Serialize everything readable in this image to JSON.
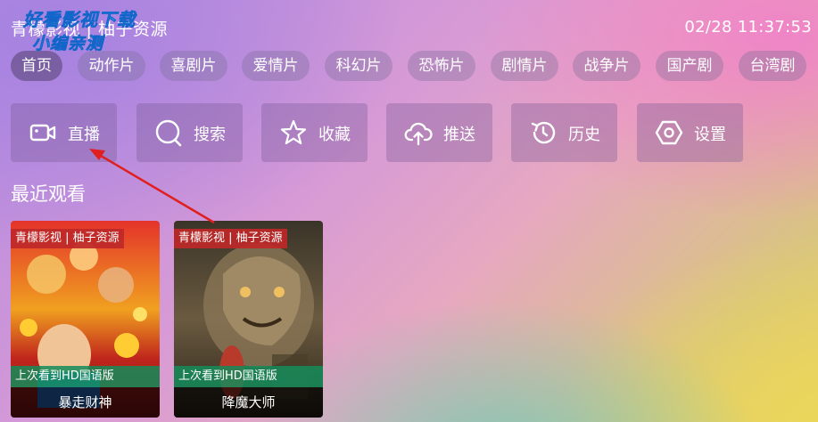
{
  "header": {
    "app_title": "青檬影视 | 柚子资源",
    "watermark_line1": "好看影视下载",
    "watermark_line2": "小编亲测",
    "clock": "02/28 11:37:53"
  },
  "tabs": [
    {
      "label": "首页",
      "active": true
    },
    {
      "label": "动作片"
    },
    {
      "label": "喜剧片"
    },
    {
      "label": "爱情片"
    },
    {
      "label": "科幻片"
    },
    {
      "label": "恐怖片"
    },
    {
      "label": "剧情片"
    },
    {
      "label": "战争片"
    },
    {
      "label": "国产剧"
    },
    {
      "label": "台湾剧"
    }
  ],
  "tiles": [
    {
      "label": "直播",
      "icon": "video-camera-icon"
    },
    {
      "label": "搜索",
      "icon": "search-icon"
    },
    {
      "label": "收藏",
      "icon": "star-icon"
    },
    {
      "label": "推送",
      "icon": "cloud-upload-icon"
    },
    {
      "label": "历史",
      "icon": "history-icon"
    },
    {
      "label": "设置",
      "icon": "settings-hexagon-icon"
    }
  ],
  "recent": {
    "title": "最近观看",
    "items": [
      {
        "badge": "青檬影视 | 柚子资源",
        "progress": "上次看到HD国语版",
        "name": "暴走财神"
      },
      {
        "badge": "青檬影视 | 柚子资源",
        "progress": "上次看到HD国语版",
        "name": "降魔大师"
      }
    ]
  },
  "colors": {
    "badge": "#be2828",
    "progress_bar": "#148c5a",
    "annotation_arrow": "#e02020"
  }
}
